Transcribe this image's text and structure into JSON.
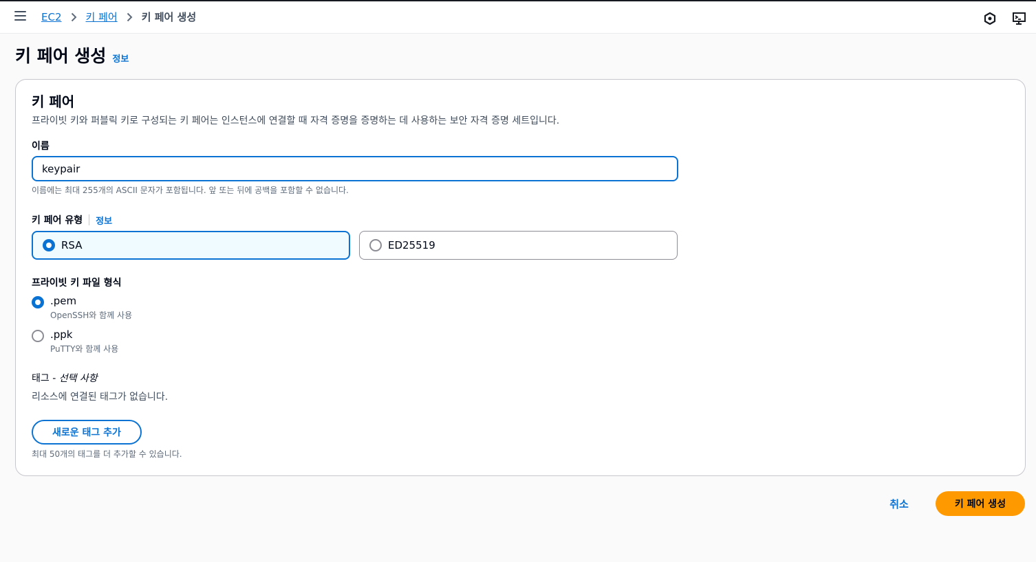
{
  "topbar": {
    "menu_icon": "hamburger-menu-icon",
    "breadcrumbs": [
      {
        "label": "EC2"
      },
      {
        "label": "키 페어"
      },
      {
        "label": "키 페어 생성"
      }
    ],
    "right_icons": [
      "hexagon-settings-icon",
      "cloudshell-terminal-icon"
    ]
  },
  "page": {
    "title": "키 페어 생성",
    "info_label": "정보"
  },
  "keypair": {
    "heading": "키 페어",
    "description": "프라이빗 키와 퍼블릭 키로 구성되는 키 페어는 인스턴스에 연결할 때 자격 증명을 증명하는 데 사용하는 보안 자격 증명 세트입니다.",
    "name_label": "이름",
    "name_value": "keypair",
    "name_hint": "이름에는 최대 255개의 ASCII 문자가 포함됩니다. 앞 또는 뒤에 공백을 포함할 수 없습니다.",
    "type_label": "키 페어 유형",
    "type_info": "정보",
    "types": [
      {
        "label": "RSA",
        "selected": true
      },
      {
        "label": "ED25519",
        "selected": false
      }
    ],
    "format_label": "프라이빗 키 파일 형식",
    "formats": [
      {
        "label": ".pem",
        "description": "OpenSSH와 함께 사용",
        "selected": true
      },
      {
        "label": ".ppk",
        "description": "PuTTY와 함께 사용",
        "selected": false
      }
    ],
    "tags_label": "태그 -",
    "tags_optional": "선택 사항",
    "tags_empty": "리소스에 연결된 태그가 없습니다.",
    "add_tag_label": "새로운 태그 추가",
    "tags_hint": "최대 50개의 태그를 더 추가할 수 있습니다."
  },
  "actions": {
    "cancel_label": "취소",
    "create_label": "키 페어 생성"
  },
  "colors": {
    "link": "#0972d3",
    "primary_button": "#ff9900",
    "selected_tile_bg": "#f0fbff"
  }
}
